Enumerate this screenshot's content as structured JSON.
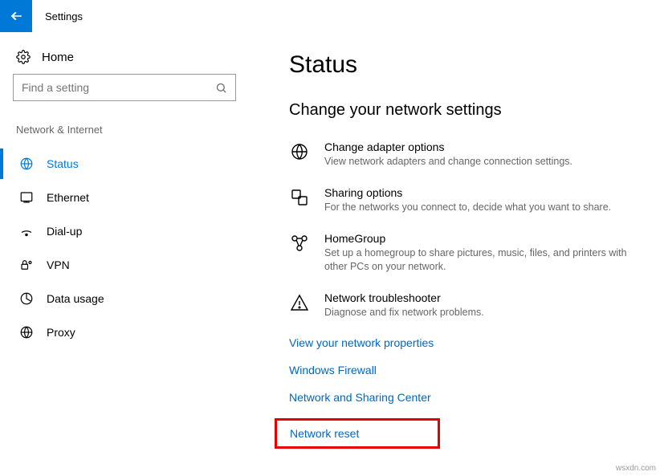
{
  "header": {
    "title": "Settings"
  },
  "sidebar": {
    "home_label": "Home",
    "search_placeholder": "Find a setting",
    "section_label": "Network & Internet",
    "items": [
      {
        "label": "Status",
        "active": true
      },
      {
        "label": "Ethernet",
        "active": false
      },
      {
        "label": "Dial-up",
        "active": false
      },
      {
        "label": "VPN",
        "active": false
      },
      {
        "label": "Data usage",
        "active": false
      },
      {
        "label": "Proxy",
        "active": false
      }
    ]
  },
  "main": {
    "page_title": "Status",
    "section_title": "Change your network settings",
    "options": [
      {
        "title": "Change adapter options",
        "desc": "View network adapters and change connection settings."
      },
      {
        "title": "Sharing options",
        "desc": "For the networks you connect to, decide what you want to share."
      },
      {
        "title": "HomeGroup",
        "desc": "Set up a homegroup to share pictures, music, files, and printers with other PCs on your network."
      },
      {
        "title": "Network troubleshooter",
        "desc": "Diagnose and fix network problems."
      }
    ],
    "links": [
      "View your network properties",
      "Windows Firewall",
      "Network and Sharing Center",
      "Network reset"
    ]
  },
  "attribution": "wsxdn.com"
}
